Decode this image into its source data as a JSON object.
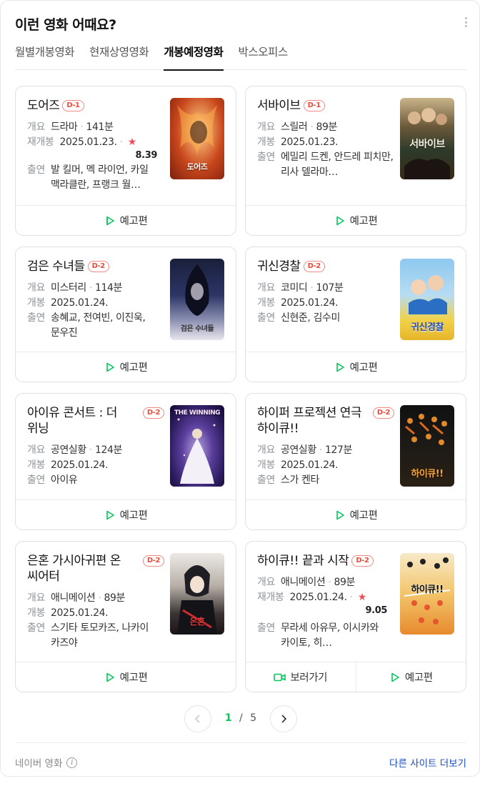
{
  "header": {
    "title": "이런 영화 어때요?"
  },
  "tabs": [
    {
      "label": "월별개봉영화",
      "active": false
    },
    {
      "label": "현재상영영화",
      "active": false
    },
    {
      "label": "개봉예정영화",
      "active": true
    },
    {
      "label": "박스오피스",
      "active": false
    }
  ],
  "labels": {
    "overview": "개요",
    "release": "개봉",
    "rerelease": "재개봉",
    "cast": "출연",
    "trailer": "예고편",
    "watch": "보러가기"
  },
  "movies": [
    {
      "title": "도어즈",
      "dday": "D-1",
      "genre": "드라마",
      "runtime": "141분",
      "date_label": "재개봉",
      "date": "2025.01.23.",
      "rating": "8.39",
      "cast": "발 킬머, 멕 라이언, 카일 맥라클란, 프랭크 월…",
      "poster_text": "도어즈"
    },
    {
      "title": "서바이브",
      "dday": "D-1",
      "genre": "스릴러",
      "runtime": "89분",
      "date_label": "개봉",
      "date": "2025.01.23.",
      "cast": "에밀리 드켄, 안드레 피치만, 리사 델라마…",
      "poster_text": "서바이브"
    },
    {
      "title": "검은 수녀들",
      "dday": "D-2",
      "genre": "미스터리",
      "runtime": "114분",
      "date_label": "개봉",
      "date": "2025.01.24.",
      "cast": "송혜교, 전여빈, 이진욱, 문우진",
      "poster_text": "검은 수녀들"
    },
    {
      "title": "귀신경찰",
      "dday": "D-2",
      "genre": "코미디",
      "runtime": "107분",
      "date_label": "개봉",
      "date": "2025.01.24.",
      "cast": "신현준, 김수미",
      "poster_text": "귀신경찰"
    },
    {
      "title": "아이유 콘서트 : 더 위닝",
      "dday": "D-2",
      "genre": "공연실황",
      "runtime": "124분",
      "date_label": "개봉",
      "date": "2025.01.24.",
      "cast": "아이유",
      "poster_text": "THE WINNING"
    },
    {
      "title": "하이퍼 프로젝션 연극 하이큐!!",
      "dday": "D-2",
      "genre": "공연실황",
      "runtime": "127분",
      "date_label": "개봉",
      "date": "2025.01.24.",
      "cast": "스가 켄타",
      "poster_text": "하이큐!!"
    },
    {
      "title": "은혼 가시아귀편 온 씨어터",
      "dday": "D-2",
      "genre": "애니메이션",
      "runtime": "89분",
      "date_label": "개봉",
      "date": "2025.01.24.",
      "cast": "스기타 토모카즈, 나카이 카즈야",
      "poster_text": "은혼"
    },
    {
      "title": "하이큐!! 끝과 시작",
      "dday": "D-2",
      "genre": "애니메이션",
      "runtime": "89분",
      "date_label": "재개봉",
      "date": "2025.01.24.",
      "rating": "9.05",
      "cast": "무라세 아유무, 이시카와 카이토, 히…",
      "poster_text": "하이큐!!"
    }
  ],
  "pagination": {
    "current": "1",
    "separator": "/",
    "total": "5"
  },
  "footer": {
    "source": "네이버 영화",
    "other_sites": "다른 사이트 더보기"
  },
  "colors": {
    "accent": "#03c75a",
    "dday": "#e74c3c",
    "link": "#1a4dc2",
    "star": "#ef4d55"
  }
}
